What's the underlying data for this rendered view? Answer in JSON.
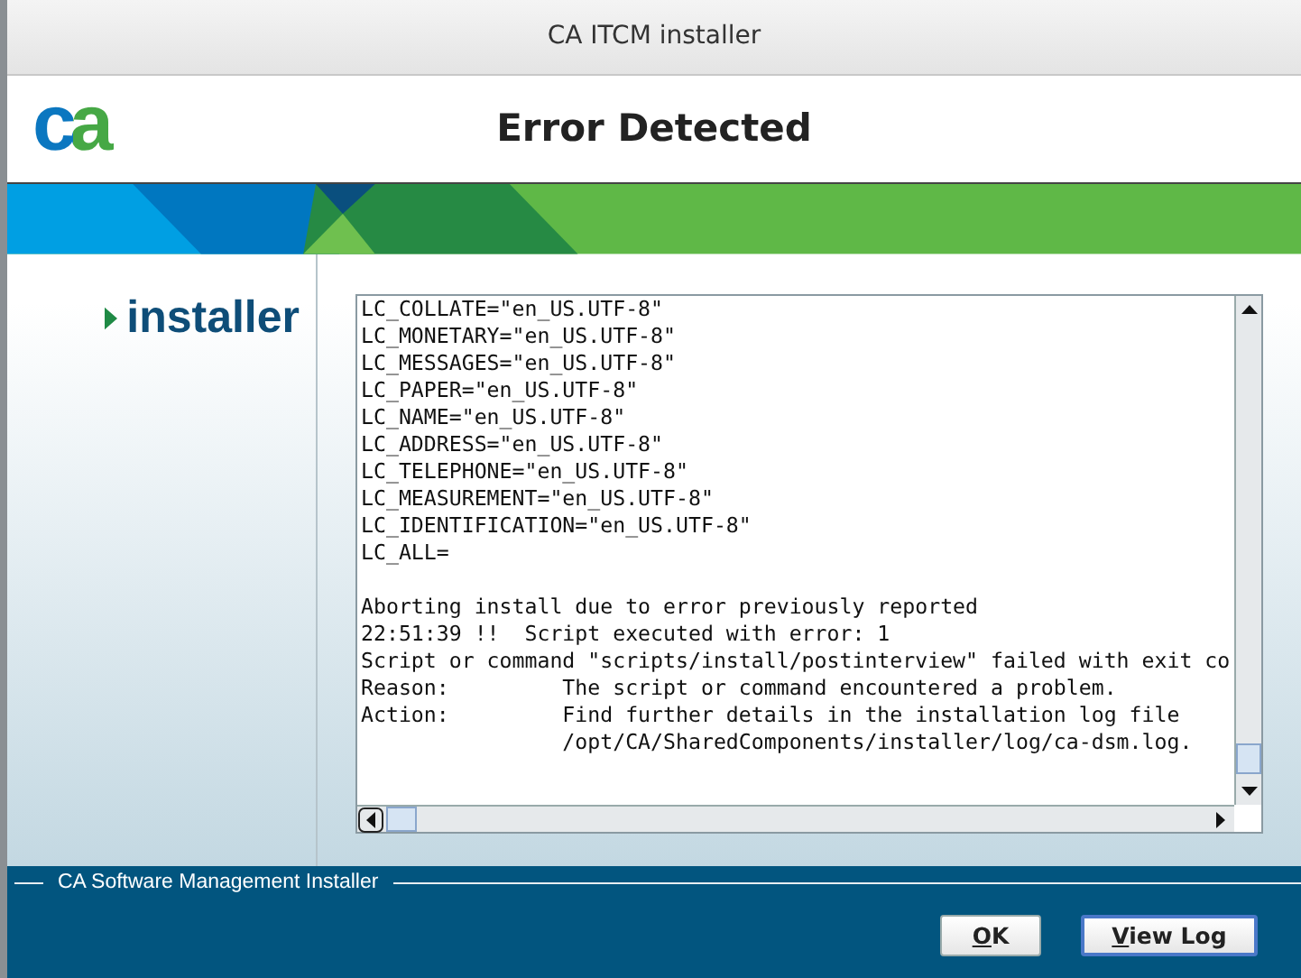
{
  "window": {
    "title": "CA ITCM installer"
  },
  "header": {
    "logo": "ca",
    "title": "Error Detected"
  },
  "sidebar": {
    "label": "installer"
  },
  "log": {
    "blocks": [
      [
        "LC_COLLATE=\"en_US.UTF-8\"",
        "LC_MONETARY=\"en_US.UTF-8\"",
        "LC_MESSAGES=\"en_US.UTF-8\"",
        "LC_PAPER=\"en_US.UTF-8\"",
        "LC_NAME=\"en_US.UTF-8\"",
        "LC_ADDRESS=\"en_US.UTF-8\"",
        "LC_TELEPHONE=\"en_US.UTF-8\"",
        "LC_MEASUREMENT=\"en_US.UTF-8\"",
        "LC_IDENTIFICATION=\"en_US.UTF-8\"",
        "LC_ALL="
      ],
      [
        "Aborting install due to error previously reported",
        "22:51:39 !!  Script executed with error: 1",
        "Script or command \"scripts/install/postinterview\" failed with exit co",
        "Reason:         The script or command encountered a problem.",
        "Action:         Find further details in the installation log file",
        "                /opt/CA/SharedComponents/installer/log/ca-dsm.log."
      ]
    ]
  },
  "footer": {
    "label": "CA Software Management Installer",
    "buttons": [
      {
        "mnemonic": "O",
        "rest": "K",
        "default": false
      },
      {
        "mnemonic": "V",
        "rest": "iew Log",
        "default": true
      }
    ]
  }
}
